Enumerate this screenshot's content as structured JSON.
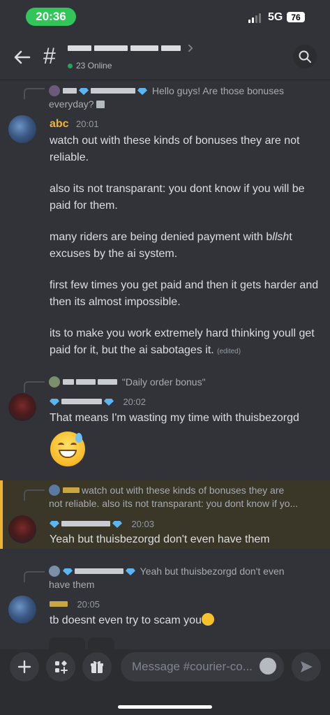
{
  "status_bar": {
    "time": "20:36",
    "network": "5G",
    "battery": "76"
  },
  "header": {
    "online": "23 Online"
  },
  "messages": [
    {
      "reply_preview": "Hello guys! Are those bonuses everyday?",
      "author": "abc",
      "time": "20:01",
      "paragraphs": [
        "watch out with these kinds of bonuses they are not reliable.",
        "also its not transparant: you dont know if you will be paid for them.",
        "first few times you get paid and then it gets harder and then its almost impossible.",
        "its to make you work extremely hard thinking youll get paid for it, but the ai sabotages it."
      ],
      "p3_a": "many riders are being denied payment with b",
      "p3_b": "llsh",
      "p3_c": "t excuses by the ai system.",
      "edited": "(edited)"
    },
    {
      "reply_preview": "\"Daily order bonus\"",
      "time": "20:02",
      "text": "That means I'm wasting my time with thuisbezorgd"
    },
    {
      "reply_preview_line1": "watch out with these kinds of bonuses they are",
      "reply_preview_line2": "not reliable.   also its not transparant: you dont know if yo...",
      "time": "20:03",
      "text": "Yeah but thuisbezorgd don't even have them"
    },
    {
      "reply_preview_line1": "Yeah but thuisbezorgd don't even",
      "reply_preview_line2": "have them",
      "time": "20:05",
      "text": "tb doesnt even try to scam you"
    }
  ],
  "composer": {
    "placeholder": "Message #courier-co..."
  },
  "colors": {
    "background": "#313338",
    "accent_gold": "#f0b232",
    "online_green": "#23a55a",
    "status_green": "#32c55a"
  }
}
